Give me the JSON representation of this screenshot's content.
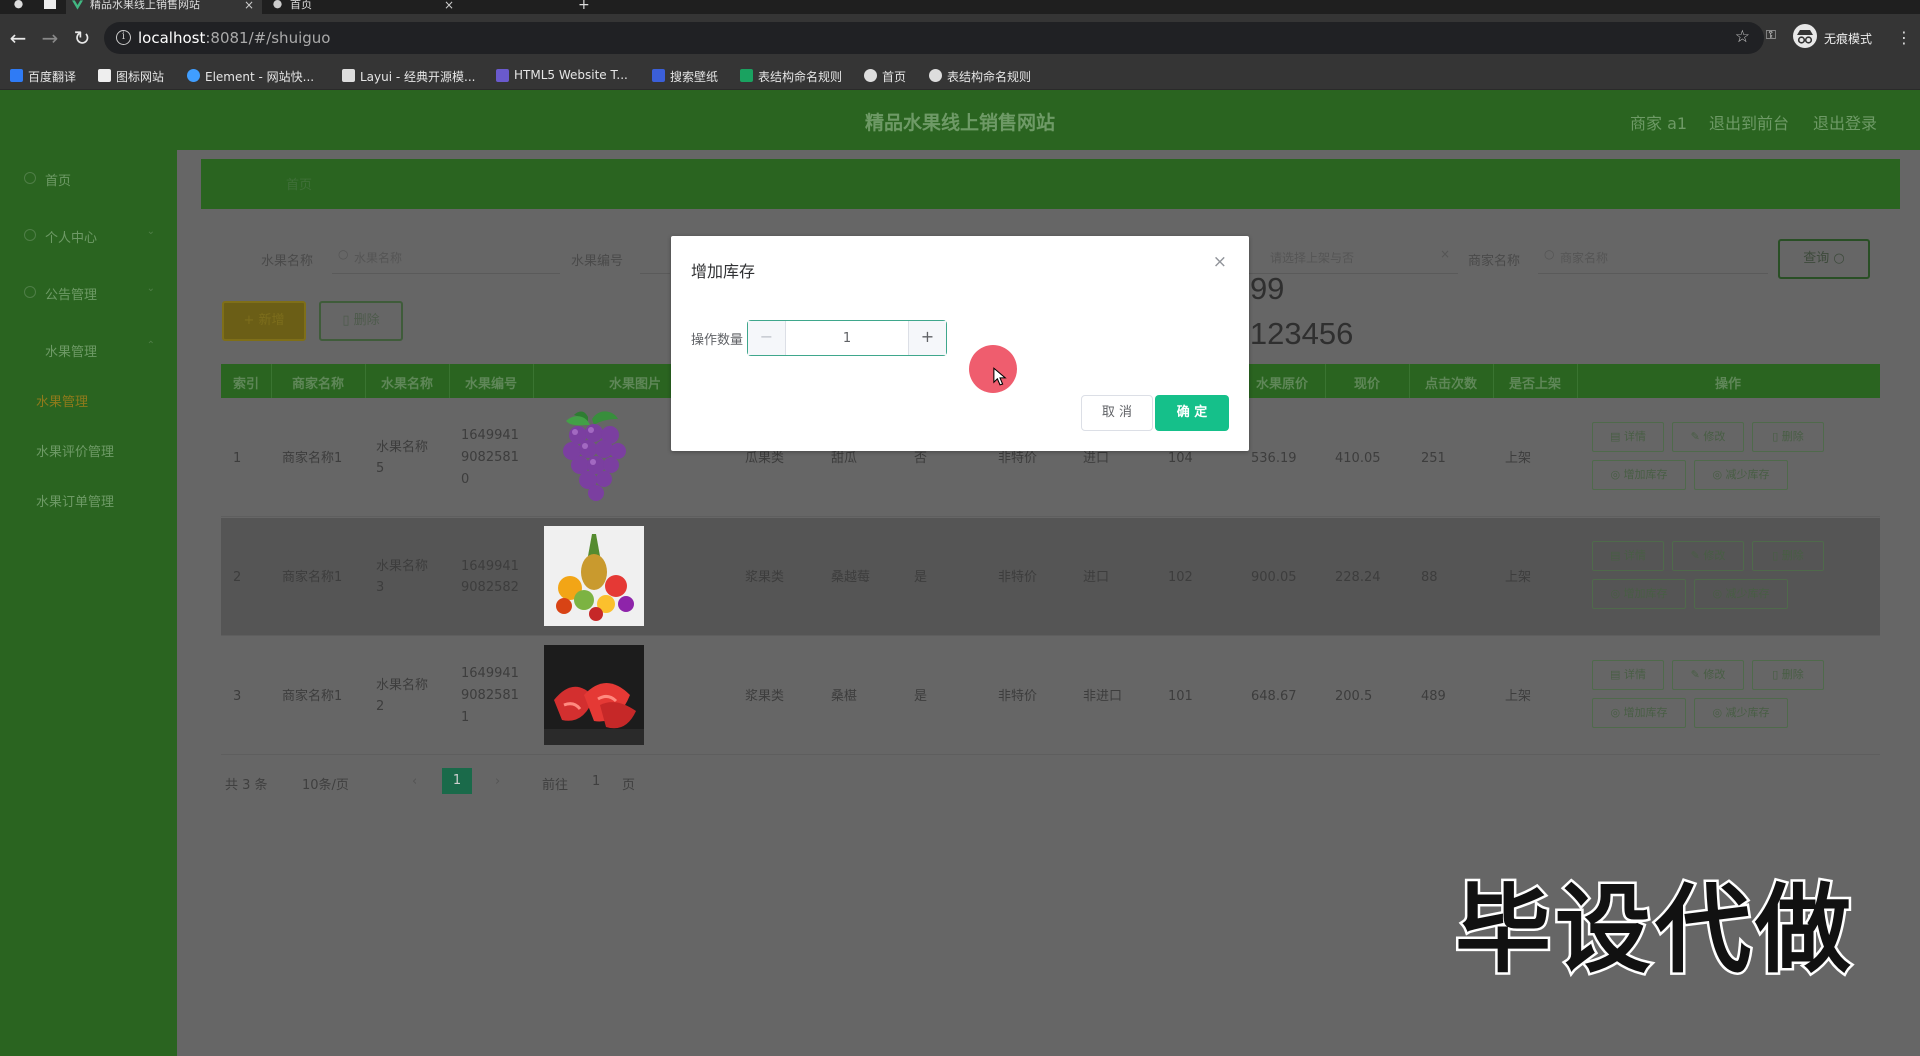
{
  "browser": {
    "tabs": [
      {
        "title": "精品水果线上销售网站",
        "active": true
      },
      {
        "title": "首页",
        "active": false
      }
    ],
    "url_host": "localhost",
    "url_rest": ":8081/#/shuiguo",
    "incognito_label": "无痕模式",
    "bookmarks": [
      {
        "label": "百度翻译",
        "color": "#2f7bf5"
      },
      {
        "label": "图标网站",
        "color": "#eeeeee"
      },
      {
        "label": "Element - 网站快...",
        "color": "#409eff"
      },
      {
        "label": "Layui - 经典开源模...",
        "color": "#dddddd"
      },
      {
        "label": "HTML5 Website T...",
        "color": "#6a5acd"
      },
      {
        "label": "搜索壁纸",
        "color": "#3b5fd9"
      },
      {
        "label": "表结构命名规则",
        "color": "#1aa260"
      },
      {
        "label": "首页",
        "color": "#dddddd"
      },
      {
        "label": "表结构命名规则",
        "color": "#dddddd"
      }
    ]
  },
  "header": {
    "title": "精品水果线上销售网站",
    "user": "商家 a1",
    "to_front": "退出到前台",
    "logout": "退出登录"
  },
  "sidebar": {
    "home": "首页",
    "personal": "个人中心",
    "notice": "公告管理",
    "fruit": "水果管理",
    "fruit_sub": "水果管理",
    "fruit_review": "水果评价管理",
    "fruit_order": "水果订单管理"
  },
  "breadcrumb": "首页",
  "search": {
    "name_label": "水果名称",
    "name_placeholder": "水果名称",
    "code_label": "水果编号",
    "type_placeholder": "请选择上架与否",
    "merchant_label": "商家名称",
    "merchant_placeholder": "商家名称",
    "query_button": "查询"
  },
  "actions": {
    "add": "+ 新增",
    "delete": "删除"
  },
  "table": {
    "headers": [
      "索引",
      "商家名称",
      "水果名称",
      "水果编号",
      "水果图片",
      "水果原价",
      "现价",
      "点击次数",
      "是否上架",
      "操作"
    ],
    "rows": [
      {
        "index": "1",
        "merchant": "商家名称1",
        "name1": "水果名称",
        "name2": "5",
        "code1": "1649941",
        "code2": "9082581",
        "code3": "0",
        "category": "瓜果类",
        "taste": "甜瓜",
        "special": "否",
        "price_type": "非特价",
        "origin": "进口",
        "stock": "104",
        "orig_price": "536.19",
        "price": "410.05",
        "clicks": "251",
        "shelf": "上架",
        "image": "grapes"
      },
      {
        "index": "2",
        "merchant": "商家名称1",
        "name1": "水果名称",
        "name2": "3",
        "code1": "1649941",
        "code2": "9082582",
        "code3": "",
        "category": "浆果类",
        "taste": "桑越莓",
        "special": "是",
        "price_type": "非特价",
        "origin": "进口",
        "stock": "102",
        "orig_price": "900.05",
        "price": "228.24",
        "clicks": "88",
        "shelf": "上架",
        "image": "fruit-mix"
      },
      {
        "index": "3",
        "merchant": "商家名称1",
        "name1": "水果名称",
        "name2": "2",
        "code1": "1649941",
        "code2": "9082581",
        "code3": "1",
        "category": "浆果类",
        "taste": "桑椹",
        "special": "是",
        "price_type": "非特价",
        "origin": "非进口",
        "stock": "101",
        "orig_price": "648.67",
        "price": "200.5",
        "clicks": "489",
        "shelf": "上架",
        "image": "strawberries"
      }
    ],
    "row_actions": {
      "detail": "详情",
      "edit": "修改",
      "delete": "删除",
      "add_stock": "增加库存",
      "reduce_stock": "减少库存"
    }
  },
  "pagination": {
    "total": "共 3 条",
    "page_size": "10条/页",
    "current": "1",
    "goto_prefix": "前往",
    "goto_value": "1",
    "goto_suffix": "页"
  },
  "dialog": {
    "title": "增加库存",
    "field_label": "操作数量",
    "value": "1",
    "minus": "−",
    "plus": "+",
    "cancel": "取 消",
    "confirm": "确 定",
    "close": "×"
  },
  "watermark": {
    "line1": "git:chenqi199",
    "line2": "v x:chen_q123456",
    "promo": "毕设代做"
  },
  "colors": {
    "brand_green": "#2a6420",
    "confirm_green": "#15c08a",
    "active_sub": "#8f7a1b"
  }
}
